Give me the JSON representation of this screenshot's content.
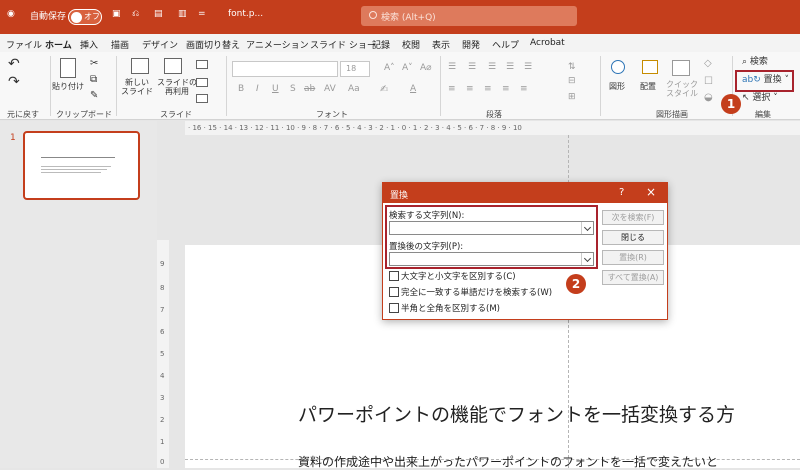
{
  "titlebar": {
    "autosave_label": "自動保存",
    "autosave_state": "オフ",
    "filename": "font.p...",
    "search_placeholder": "検索 (Alt+Q)"
  },
  "menu": {
    "tabs": [
      "ファイル",
      "ホーム",
      "挿入",
      "描画",
      "デザイン",
      "画面切り替え",
      "アニメーション",
      "スライド ショー",
      "記録",
      "校閲",
      "表示",
      "開発",
      "ヘルプ",
      "Acrobat"
    ],
    "active": "ホーム"
  },
  "ribbon": {
    "undo_group": "元に戻す",
    "clipboard": {
      "paste": "貼り付け",
      "group": "クリップボード"
    },
    "slides": {
      "new_slide": "新しい\nスライド",
      "reuse_slide": "スライドの\n再利用",
      "group": "スライド"
    },
    "font": {
      "size": "18",
      "group": "フォント"
    },
    "paragraph": {
      "group": "段落"
    },
    "drawing": {
      "shapes": "図形",
      "arrange": "配置",
      "quick_styles": "クイック\nスタイル",
      "group": "図形描画"
    },
    "editing": {
      "find": "検索",
      "replace": "置換",
      "select": "選択",
      "group": "編集"
    }
  },
  "ruler_top": "· 16 · 15 · 14 · 13 · 12 · 11 · 10 · 9 · 8 · 7 · 6 · 5 · 4 · 3 · 2 · 1 · 0 · 1 · 2 · 3 · 4 · 5 · 6 · 7 · 8 · 9 · 10",
  "ruler_left": [
    "9",
    "8",
    "7",
    "6",
    "5",
    "4",
    "3",
    "2",
    "1",
    "0"
  ],
  "slide_panel": {
    "slide_number": "1"
  },
  "slide": {
    "title": "パワーポイントの機能でフォントを一括変換する方",
    "body": "資料の作成途中や出来上がったパワーポイントのフォントを一括で変えたいと"
  },
  "dialog": {
    "title": "置換",
    "help": "?",
    "close": "×",
    "find_label": "検索する文字列(N):",
    "replace_label": "置換後の文字列(P):",
    "find_value": "",
    "replace_value": "",
    "buttons": {
      "find_next": "次を検索(F)",
      "close": "閉じる",
      "replace": "置換(R)",
      "replace_all": "すべて置換(A)"
    },
    "options": [
      "大文字と小文字を区別する(C)",
      "完全に一致する単語だけを検索する(W)",
      "半角と全角を区別する(M)"
    ]
  },
  "callouts": {
    "step1": "1",
    "step2": "2"
  },
  "colors": {
    "accent": "#c43e1c",
    "highlight": "#a8232d"
  }
}
